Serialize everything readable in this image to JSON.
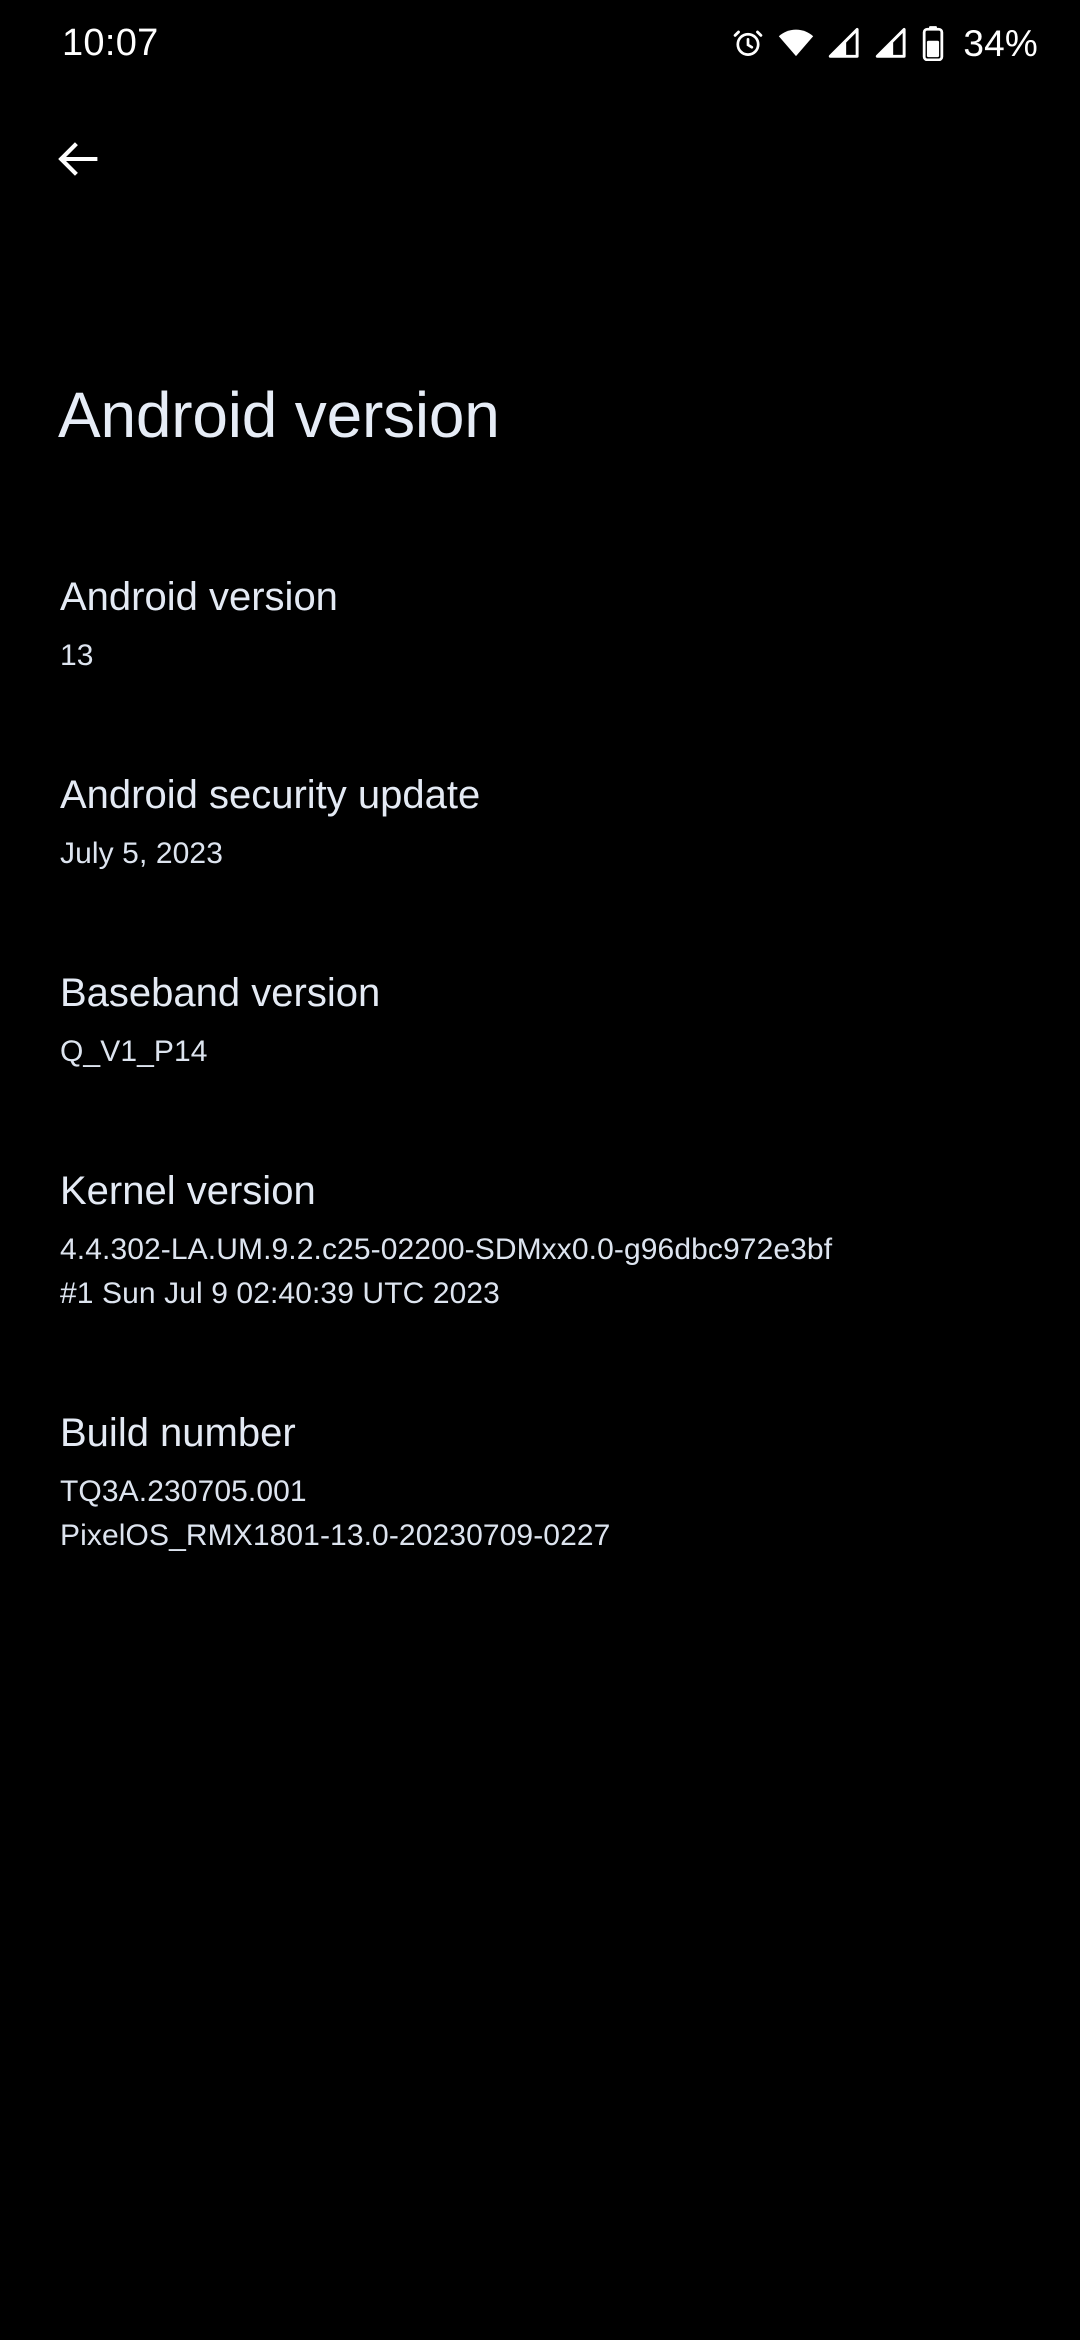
{
  "status_bar": {
    "time": "10:07",
    "battery_percent": "34%",
    "icons": [
      "alarm-icon",
      "wifi-icon",
      "signal-sim1-icon",
      "signal-sim2-icon",
      "battery-icon"
    ]
  },
  "appbar": {
    "back_label": "Back",
    "back_icon": "arrow-back-icon"
  },
  "page": {
    "title": "Android version"
  },
  "colors": {
    "background": "#000000",
    "text_primary": "#e4eaf4",
    "text_secondary": "#dde4ef",
    "status_text": "#ffffff"
  },
  "items": [
    {
      "title": "Android version",
      "lines": [
        "13"
      ]
    },
    {
      "title": "Android security update",
      "lines": [
        "July 5, 2023"
      ]
    },
    {
      "title": "Baseband version",
      "lines": [
        "Q_V1_P14"
      ]
    },
    {
      "title": "Kernel version",
      "lines": [
        "4.4.302-LA.UM.9.2.c25-02200-SDMxx0.0-g96dbc972e3bf",
        "#1 Sun Jul 9 02:40:39 UTC 2023"
      ]
    },
    {
      "title": "Build number",
      "lines": [
        "TQ3A.230705.001",
        "PixelOS_RMX1801-13.0-20230709-0227"
      ]
    }
  ]
}
